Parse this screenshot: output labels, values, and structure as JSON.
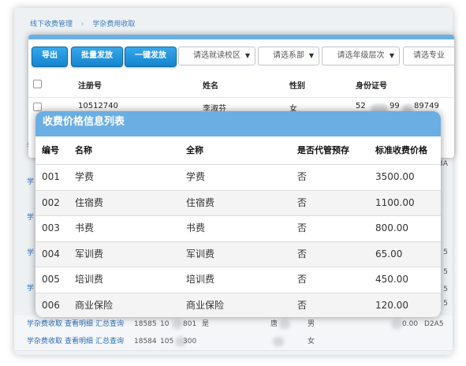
{
  "breadcrumb": [
    "线下收费管理",
    "学杂费用收取"
  ],
  "toolbar": {
    "export_label": "导出",
    "batch_label": "批量发放",
    "oneclick_label": "一键发放",
    "campus_placeholder": "请选就读校区",
    "dept_placeholder": "请选系部",
    "grade_placeholder": "请选年级层次",
    "major_placeholder": "请选专业"
  },
  "student_list": {
    "columns": [
      "注册号",
      "姓名",
      "性别",
      "身份证号"
    ],
    "rows": [
      {
        "reg_no": "10512740",
        "name": "李淑芬",
        "gender": "女",
        "id_prefix": "52",
        "id_mid": "99",
        "id_suffix": "89749"
      }
    ]
  },
  "background_rows": [
    {
      "links": [
        "学杂费收取",
        "查看明细",
        "汇总查询"
      ],
      "num": "18585",
      "reg": "10",
      "reg_tail": "801",
      "flag": "是",
      "name": "唐",
      "gender": "男",
      "amount": "0.00",
      "code": "D2A5"
    },
    {
      "links": [
        "学杂费收取",
        "查看明细",
        "汇总查询"
      ],
      "num": "18584",
      "reg": "105",
      "reg_tail": "300",
      "flag": "",
      "name": "",
      "gender": "女",
      "amount": "",
      "code": ""
    }
  ],
  "background_edge": {
    "right_tails": [
      "3A",
      "3A",
      "5",
      "5",
      "5",
      "5",
      "5"
    ],
    "left_label": "学"
  },
  "price_modal": {
    "title": "收费价格信息列表",
    "columns": [
      "编号",
      "名称",
      "全称",
      "是否代管预存",
      "标准收费价格"
    ],
    "rows": [
      {
        "code": "001",
        "name": "学费",
        "full_name": "学费",
        "custodial": "否",
        "price": "3500.00"
      },
      {
        "code": "002",
        "name": "住宿费",
        "full_name": "住宿费",
        "custodial": "否",
        "price": "1100.00"
      },
      {
        "code": "003",
        "name": "书费",
        "full_name": "书费",
        "custodial": "否",
        "price": "800.00"
      },
      {
        "code": "004",
        "name": "军训费",
        "full_name": "军训费",
        "custodial": "否",
        "price": "65.00"
      },
      {
        "code": "005",
        "name": "培训费",
        "full_name": "培训费",
        "custodial": "否",
        "price": "450.00"
      },
      {
        "code": "006",
        "name": "商业保险",
        "full_name": "商业保险",
        "custodial": "否",
        "price": "120.00"
      }
    ]
  }
}
